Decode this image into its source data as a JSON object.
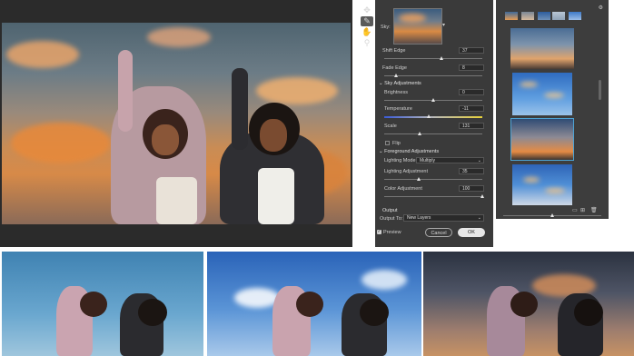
{
  "panel": {
    "sky_label": "Sky:",
    "shift_edge_label": "Shift Edge",
    "shift_edge_value": "37",
    "shift_edge_fraction": 0.58,
    "fade_edge_label": "Fade Edge",
    "fade_edge_value": "8",
    "fade_edge_fraction": 0.12,
    "sky_adjustments_header": "Sky Adjustments",
    "brightness_label": "Brightness",
    "brightness_value": "0",
    "brightness_fraction": 0.5,
    "temperature_label": "Temperature",
    "temperature_value": "-11",
    "temperature_fraction": 0.45,
    "scale_label": "Scale",
    "scale_value": "131",
    "scale_fraction": 0.36,
    "flip_label": "Flip",
    "foreground_header": "Foreground Adjustments",
    "lighting_mode_label": "Lighting Mode:",
    "lighting_mode_value": "Multiply",
    "lighting_adjustment_label": "Lighting Adjustment",
    "lighting_adjustment_value": "35",
    "lighting_adjustment_fraction": 0.35,
    "color_adjustment_label": "Color Adjustment",
    "color_adjustment_value": "100",
    "color_adjustment_fraction": 1.0,
    "output_header": "Output",
    "output_to_label": "Output To:",
    "output_to_value": "New Layers",
    "preview_label": "Preview",
    "cancel_label": "Cancel",
    "ok_label": "OK"
  },
  "icons": {
    "move": "move-tool-icon",
    "brush": "sky-brush-icon",
    "hand": "hand-tool-icon",
    "zoom": "zoom-tool-icon",
    "gear": "gear-icon",
    "folder": "new-folder-icon",
    "add": "add-sky-icon",
    "trash": "trash-icon"
  },
  "colors": {
    "panel_bg": "#3a3a3a",
    "canvas_bg": "#2b2b2b",
    "accent_selection": "#4da3d4",
    "ok_button": "#e6e6e6"
  }
}
